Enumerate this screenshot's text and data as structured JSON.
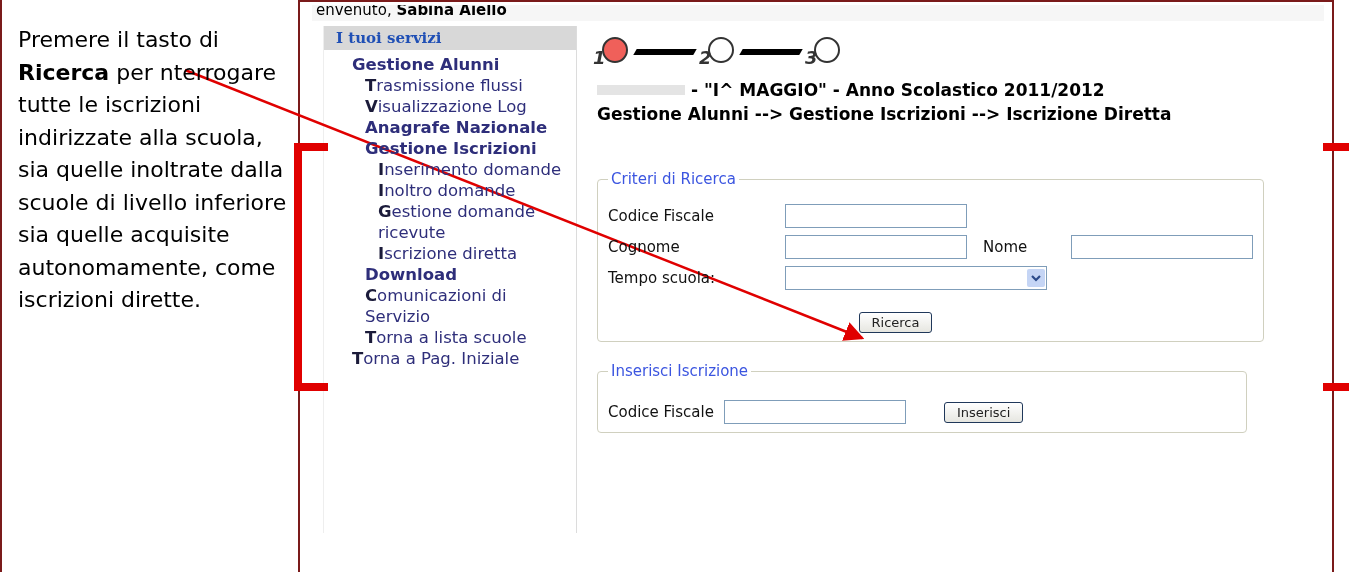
{
  "note": {
    "text": "Premere il tasto di **Ricerca** per nterrogare tutte le iscrizioni indirizzate alla scuola, sia quelle inoltrate dalla scuole di livello inferiore sia quelle acquisite autonomamente, come iscrizioni dirette."
  },
  "greeting": "envenuto, **Sabina Aiello**",
  "sidebar": {
    "title": "I tuoi servizi",
    "items": [
      {
        "label": "Gestione Alunni",
        "kind": "heading",
        "children": [
          {
            "label": "**T**rasmissione flussi",
            "kind": "link"
          },
          {
            "label": "**V**isualizzazione Log",
            "kind": "link"
          },
          {
            "label": "Anagrafe Nazionale",
            "kind": "heading"
          },
          {
            "label": "Gestione Iscrizioni",
            "kind": "heading",
            "children": [
              {
                "label": "**I**nserimento domande",
                "kind": "link"
              },
              {
                "label": "**I**noltro domande",
                "kind": "link"
              },
              {
                "label": "**G**estione domande ricevute",
                "kind": "link"
              },
              {
                "label": "**I**scrizione diretta",
                "kind": "link"
              }
            ]
          },
          {
            "label": "Download",
            "kind": "heading"
          },
          {
            "label": "**C**omunicazioni di Servizio",
            "kind": "link"
          },
          {
            "label": "**T**orna a lista scuole",
            "kind": "link"
          }
        ]
      },
      {
        "label": "**T**orna a Pag. Iniziale",
        "kind": "link"
      }
    ]
  },
  "steps": [
    {
      "label": "1",
      "selected": true
    },
    {
      "label": "2",
      "selected": false
    },
    {
      "label": "3",
      "selected": false
    }
  ],
  "school_line": "- \"I^ MAGGIO\" - Anno Scolastico 2011/2012",
  "breadcrumb": "Gestione Alunni --> Gestione Iscrizioni --> Iscrizione Diretta",
  "search_form": {
    "legend": "Criteri di Ricerca",
    "codice_label": "Codice Fiscale",
    "cognome_label": "Cognome",
    "nome_label": "Nome",
    "tempo_label": "Tempo scuola:",
    "button": "Ricerca"
  },
  "insert_form": {
    "legend": "Inserisci Iscrizione",
    "codice_label": "Codice Fiscale",
    "button": "Inserisci"
  }
}
